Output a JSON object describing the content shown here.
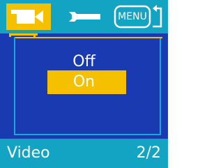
{
  "tabs": {
    "video_icon": "video-camera-icon",
    "tools_icon": "wrench-icon",
    "menu_label": "MENU"
  },
  "options": {
    "off_label": "Off",
    "on_label": "On",
    "selected": "On"
  },
  "footer": {
    "mode": "Video",
    "page": "2/2"
  },
  "colors": {
    "bar": "#13a3c3",
    "panel": "#1a3ab2",
    "highlight": "#f5c000",
    "text": "#ffffff"
  }
}
